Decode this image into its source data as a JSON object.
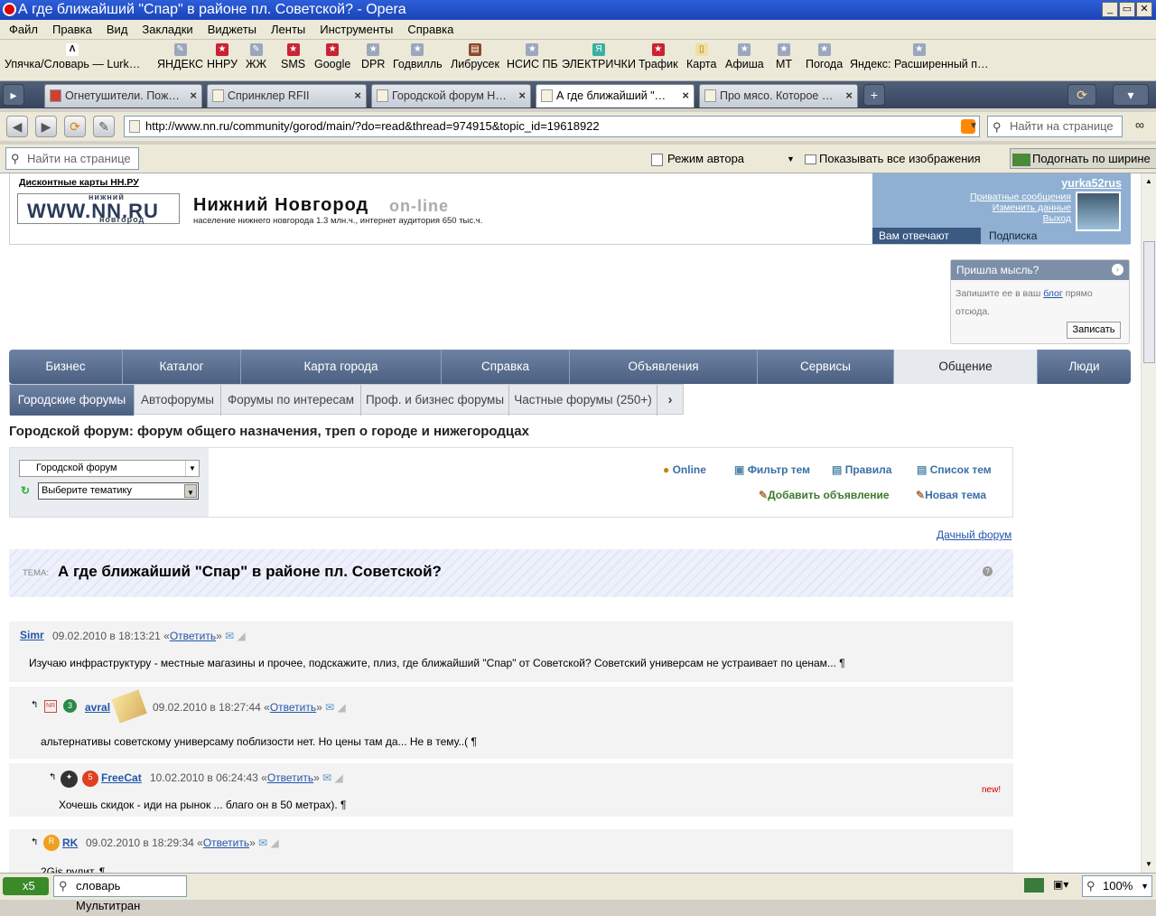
{
  "window": {
    "title": "А где ближайший \"Спар\" в районе пл. Советской? - Opera",
    "min": "_",
    "max": "▭",
    "close": "✕"
  },
  "menu": [
    "Файл",
    "Правка",
    "Вид",
    "Закладки",
    "Виджеты",
    "Ленты",
    "Инструменты",
    "Справка"
  ],
  "bookmarks": [
    "Упячка/Словарь — Lurk…",
    "ЯНДЕКС",
    "ННРУ",
    "ЖЖ",
    "SMS",
    "Google",
    "DPR",
    "Годвилль",
    "Либрусек",
    "НСИС ПБ",
    "ЭЛЕКТРИЧКИ",
    "Трафик",
    "Карта",
    "Афиша",
    "МТ",
    "Погода",
    "Яндекс: Расширенный п…"
  ],
  "tabs": [
    "Огнетушители. Пож…",
    "Спринклер RFII",
    "Городской форум Н…",
    "А где ближайший \"…",
    "Про мясо. Которое …"
  ],
  "address": {
    "url": "http://www.nn.ru/community/gorod/main/?do=read&thread=974915&topic_id=19618922",
    "search_placeholder": "Найти на странице"
  },
  "findbar": {
    "placeholder": "Найти на странице",
    "author_mode": "Режим автора",
    "show_images": "Показывать все изображения",
    "fit_width": "Подогнать по ширине"
  },
  "header": {
    "discount": "Дисконтные карты НН.РУ",
    "logo_top": "нижний",
    "logo": "WWW.NN.RU",
    "logo_bottom": "новгород",
    "site_title": "Нижний Новгород",
    "online": "on-line",
    "population": "население нижнего новгорода 1.3 млн.ч., интернет аудитория 650 тыс.ч."
  },
  "user": {
    "name": "yurka52rus",
    "links": [
      "Приватные сообщения",
      "Изменить данные",
      "Выход"
    ],
    "tab_reply": "Вам отвечают",
    "tab_sub": "Подписка"
  },
  "thought": {
    "title": "Пришла мысль?",
    "text1": "Запишите ее в ваш ",
    "blog": "блог",
    "text2": " прямо",
    "text3": "отсюда.",
    "button": "Записать"
  },
  "nav": [
    "Бизнес",
    "Каталог",
    "Карта города",
    "Справка",
    "Объявления",
    "Сервисы",
    "Общение",
    "Люди"
  ],
  "subnav": [
    "Городские форумы",
    "Автофорумы",
    "Форумы по интересам",
    "Проф. и бизнес форумы",
    "Частные форумы (250+)",
    "›"
  ],
  "forum": {
    "heading": "Городской форум: форум общего назначения, треп о городе и нижегородцах",
    "select1": "Городской форум",
    "select2": "Выберите тематику",
    "links": [
      "Online",
      "Фильтр тем",
      "Правила",
      "Список тем",
      "Добавить объявление",
      "Новая тема"
    ],
    "dacha": "Дачный форум"
  },
  "topic": {
    "label": "ТЕМА:",
    "title": "А где ближайший \"Спар\" в районе пл. Советской?"
  },
  "posts": [
    {
      "user": "Simr",
      "date": "09.02.2010 в 18:13:21",
      "reply": "Ответить",
      "text": "Изучаю инфраструктуру - местные магазины и прочее, подскажите, плиз, где ближайший \"Спар\" от Советской? Советский универсам не устраивает по ценам... ¶"
    },
    {
      "user": "avral",
      "date": "09.02.2010 в 18:27:44",
      "reply": "Ответить",
      "text": "альтернативы советскому универсаму поблизости нет. Но цены там да... Не в тему..( ¶"
    },
    {
      "user": "FreeCat",
      "date": "10.02.2010 в 06:24:43",
      "reply": "Ответить",
      "text": "Хочешь скидок - иди на рынок ... благо он в 50 метрах). ¶",
      "new": "new!"
    },
    {
      "user": "RK",
      "date": "09.02.2010 в 18:29:34",
      "reply": "Ответить",
      "text": "2Gis рулит. ¶"
    }
  ],
  "status": {
    "speed": "x5",
    "search": "словарь Мультитран",
    "zoom": "100%"
  }
}
